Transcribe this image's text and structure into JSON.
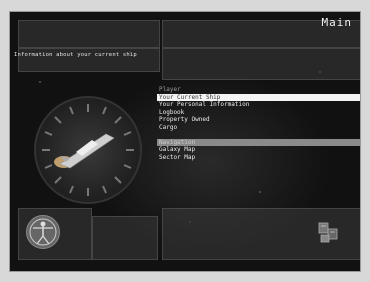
{
  "header": {
    "title": "Main",
    "info_text": "Information about your current ship"
  },
  "menu": {
    "sections": [
      {
        "heading": "Player",
        "items": [
          {
            "label": "Your Current Ship",
            "selected": true
          },
          {
            "label": "Your Personal Information"
          },
          {
            "label": "Logbook"
          },
          {
            "label": "Property Owned"
          },
          {
            "label": "Cargo"
          }
        ]
      },
      {
        "heading": "Navigation",
        "items": [
          {
            "label": "Galaxy Map"
          },
          {
            "label": "Sector Map"
          }
        ]
      }
    ]
  },
  "icons": {
    "ship": "spaceship-icon",
    "avatar": "vitruvian-man-icon",
    "tools": "computer-terminal-icon"
  }
}
